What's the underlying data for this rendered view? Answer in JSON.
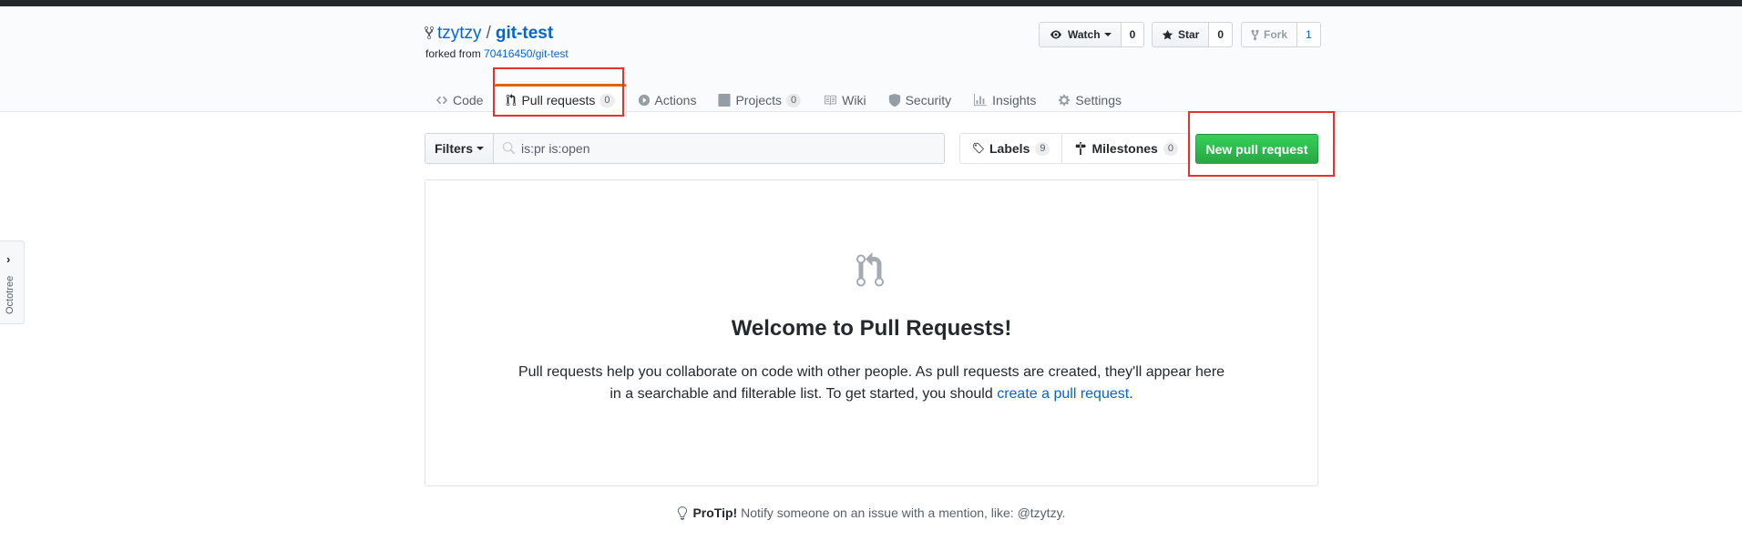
{
  "repo": {
    "owner": "tzytzy",
    "separator": "/",
    "name": "git-test",
    "forked_from_prefix": "forked from",
    "forked_from_link": "70416450/git-test"
  },
  "actions": {
    "watch_label": "Watch",
    "watch_count": "0",
    "star_label": "Star",
    "star_count": "0",
    "fork_label": "Fork",
    "fork_count": "1"
  },
  "nav": {
    "code": "Code",
    "pull_requests": "Pull requests",
    "pull_requests_count": "0",
    "actions": "Actions",
    "projects": "Projects",
    "projects_count": "0",
    "wiki": "Wiki",
    "security": "Security",
    "insights": "Insights",
    "settings": "Settings"
  },
  "toolbar": {
    "filters_label": "Filters",
    "search_value": "is:pr is:open",
    "labels_label": "Labels",
    "labels_count": "9",
    "milestones_label": "Milestones",
    "milestones_count": "0",
    "new_pr_label": "New pull request"
  },
  "blankslate": {
    "title": "Welcome to Pull Requests!",
    "text_before_link": "Pull requests help you collaborate on code with other people. As pull requests are created, they'll appear here in a searchable and filterable list. To get started, you should",
    "link_text": "create a pull request",
    "text_after_link": "."
  },
  "protip": {
    "label": "ProTip!",
    "text": "Notify someone on an issue with a mention, like: @tzytzy."
  },
  "octotree": {
    "label": "Octotree",
    "chevron": "›"
  },
  "colors": {
    "accent": "#0366d6",
    "primary_button": "#28a745",
    "highlight_box": "#e4322d",
    "selected_tab_border": "#e36209"
  }
}
